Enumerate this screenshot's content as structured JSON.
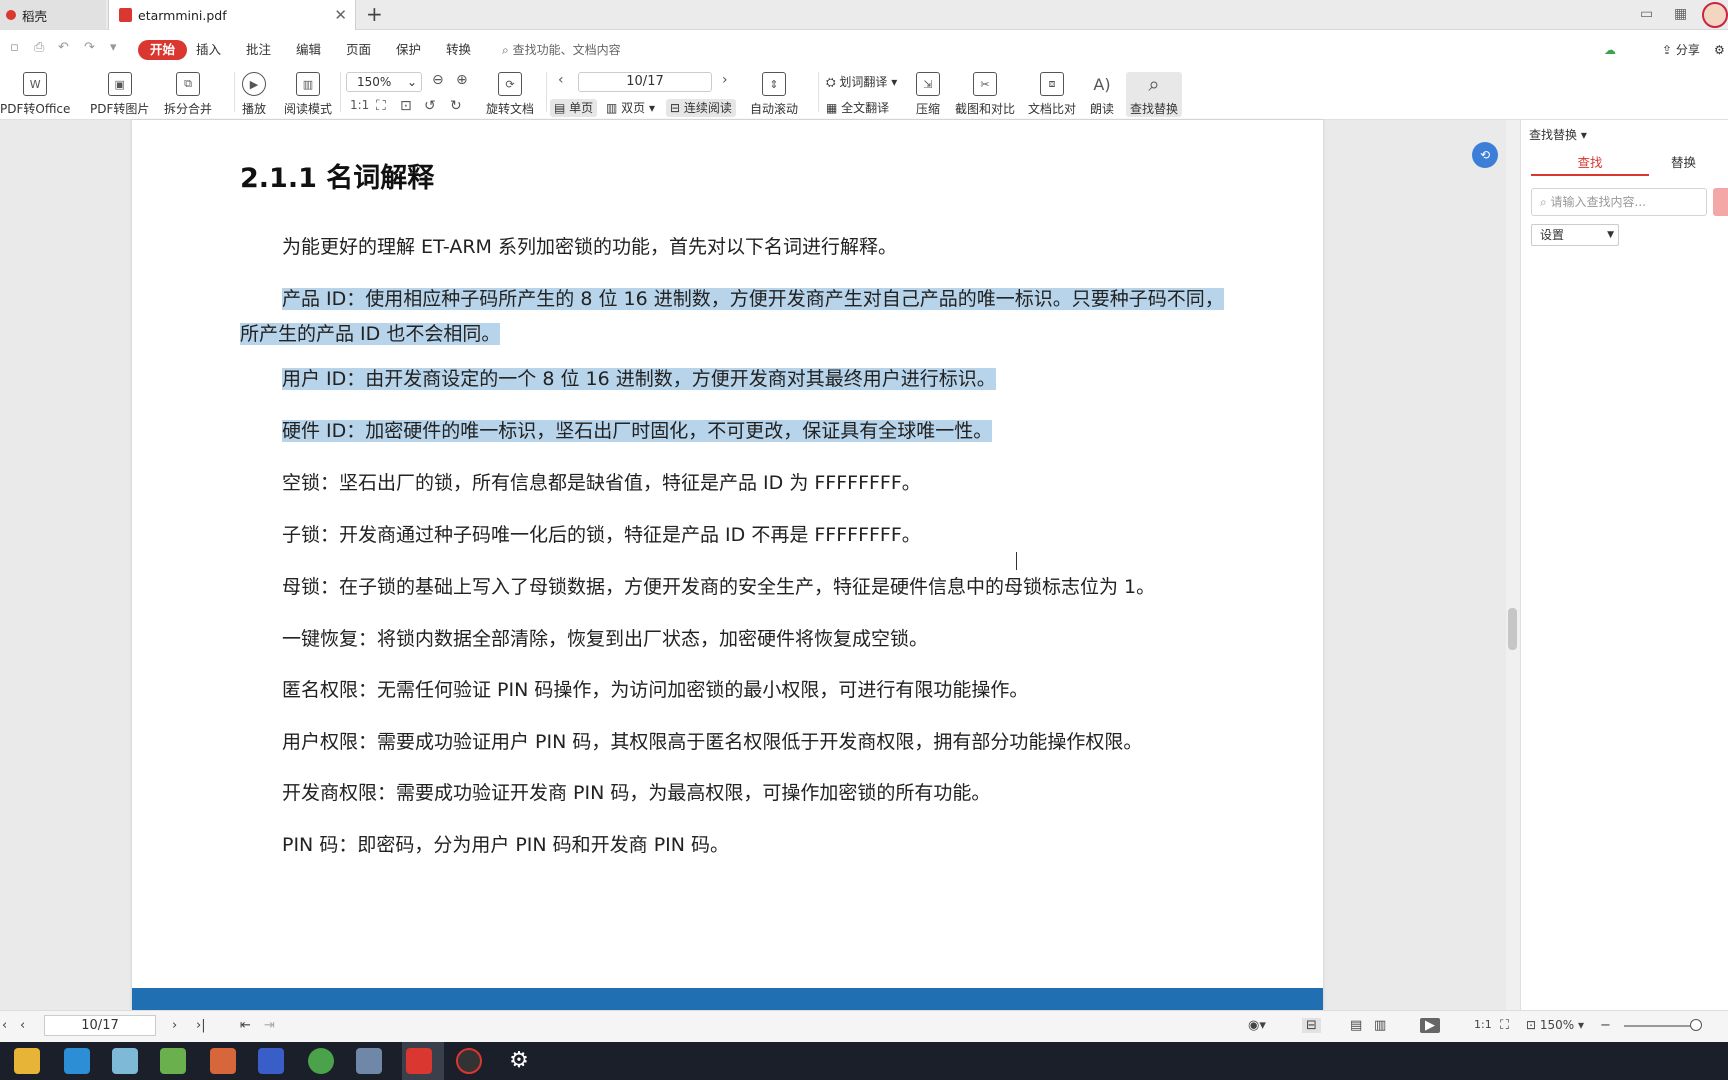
{
  "tabs": [
    {
      "label": "稻壳"
    },
    {
      "label": "etarmmini.pdf"
    }
  ],
  "menu": {
    "items": [
      "开始",
      "插入",
      "批注",
      "编辑",
      "页面",
      "保护",
      "转换"
    ],
    "search_placeholder": "查找功能、文档内容",
    "share": "分享"
  },
  "ribbon": {
    "pdf_to_office": "PDF转Office",
    "pdf_to_image": "PDF转图片",
    "split_merge": "拆分合并",
    "play": "播放",
    "read_mode": "阅读模式",
    "zoom": "150%",
    "rotate": "旋转文档",
    "page_field": "10/17",
    "single_page": "单页",
    "double_page": "双页",
    "continuous": "连续阅读",
    "auto_scroll": "自动滚动",
    "word_translate": "划词翻译",
    "full_translate": "全文翻译",
    "compress": "压缩",
    "screenshot_compare": "截图和对比",
    "doc_compare": "文档比对",
    "read_aloud": "朗读",
    "find_replace": "查找替换"
  },
  "document": {
    "heading": "2.1.1 名词解释",
    "paragraphs": [
      {
        "text": "为能更好的理解 ET-ARM 系列加密锁的功能，首先对以下名词进行解释。",
        "highlighted": false
      },
      {
        "text": "产品 ID：使用相应种子码所产生的 8 位 16 进制数，方便开发商产生对自己产品的唯一标识。只要种子码不同，所产生的产品 ID 也不会相同。",
        "highlighted": true
      },
      {
        "text": "用户 ID：由开发商设定的一个 8 位 16 进制数，方便开发商对其最终用户进行标识。",
        "highlighted": true
      },
      {
        "text": "硬件 ID：加密硬件的唯一标识，坚石出厂时固化，不可更改，保证具有全球唯一性。",
        "highlighted": true
      },
      {
        "text": "空锁：坚石出厂的锁，所有信息都是缺省值，特征是产品 ID 为 FFFFFFFF。",
        "highlighted": false
      },
      {
        "text": "子锁：开发商通过种子码唯一化后的锁，特征是产品 ID 不再是 FFFFFFFF。",
        "highlighted": false
      },
      {
        "text": "母锁：在子锁的基础上写入了母锁数据，方便开发商的安全生产，特征是硬件信息中的母锁标志位为 1。",
        "highlighted": false
      },
      {
        "text": "一键恢复：将锁内数据全部清除，恢复到出厂状态，加密硬件将恢复成空锁。",
        "highlighted": false
      },
      {
        "text": "匿名权限：无需任何验证 PIN 码操作，为访问加密锁的最小权限，可进行有限功能操作。",
        "highlighted": false
      },
      {
        "text": "用户权限：需要成功验证用户 PIN 码，其权限高于匿名权限低于开发商权限，拥有部分功能操作权限。",
        "highlighted": false
      },
      {
        "text": "开发商权限：需要成功验证开发商 PIN 码，为最高权限，可操作加密锁的所有功能。",
        "highlighted": false
      },
      {
        "text": "PIN 码：即密码，分为用户 PIN 码和开发商 PIN 码。",
        "highlighted": false
      }
    ]
  },
  "panel": {
    "title": "查找替换",
    "tab_find": "查找",
    "tab_replace": "替换",
    "search_placeholder": "请输入查找内容...",
    "settings": "设置"
  },
  "status": {
    "page_field": "10/17",
    "zoom": "150%"
  },
  "colors": {
    "accent": "#d9372f",
    "highlight": "#b8d4ea",
    "footer_band": "#1f6fb2"
  }
}
